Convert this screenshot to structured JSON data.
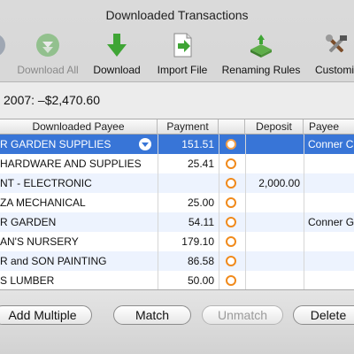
{
  "window": {
    "title": "Downloaded Transactions"
  },
  "toolbar": [
    {
      "label": "Download All",
      "icon": "download-all-icon",
      "enabled": false
    },
    {
      "label": "Download",
      "icon": "download-icon",
      "enabled": true
    },
    {
      "label": "Import File",
      "icon": "import-file-icon",
      "enabled": true
    },
    {
      "label": "Renaming Rules",
      "icon": "renaming-rules-icon",
      "enabled": true
    },
    {
      "label": "Customi",
      "icon": "tools-icon",
      "enabled": true
    }
  ],
  "summary": {
    "text": "2007: –$2,470.60"
  },
  "table": {
    "columns": [
      "Downloaded Payee",
      "Payment",
      "",
      "Deposit",
      "Payee"
    ],
    "rows": [
      {
        "payee": "R GARDEN SUPPLIES",
        "payment": "151.51",
        "deposit": "",
        "match_payee": "Conner C",
        "selected": true
      },
      {
        "payee": "HARDWARE AND SUPPLIES",
        "payment": "25.41",
        "deposit": "",
        "match_payee": ""
      },
      {
        "payee": "NT - ELECTRONIC",
        "payment": "",
        "deposit": "2,000.00",
        "match_payee": ""
      },
      {
        "payee": "ZA MECHANICAL",
        "payment": "25.00",
        "deposit": "",
        "match_payee": ""
      },
      {
        "payee": "R GARDEN",
        "payment": "54.11",
        "deposit": "",
        "match_payee": "Conner G"
      },
      {
        "payee": "AN'S NURSERY",
        "payment": "179.10",
        "deposit": "",
        "match_payee": ""
      },
      {
        "payee": "R and SON PAINTING",
        "payment": "86.58",
        "deposit": "",
        "match_payee": ""
      },
      {
        "payee": "S LUMBER",
        "payment": "50.00",
        "deposit": "",
        "match_payee": ""
      }
    ]
  },
  "buttons": {
    "add_multiple": "Add Multiple",
    "match": "Match",
    "unmatch": "Unmatch",
    "delete": "Delete"
  },
  "colors": {
    "selection": "#3875d7",
    "radio": "#f08a1c",
    "download_green": "#3fa535"
  }
}
